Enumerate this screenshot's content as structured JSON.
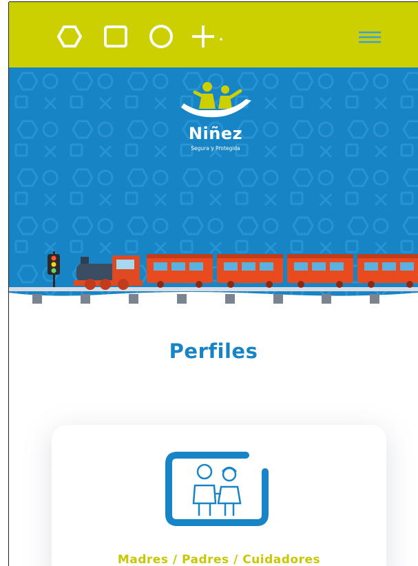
{
  "header": {
    "logo_shapes": [
      "hexagon",
      "square",
      "circle",
      "plus"
    ],
    "menu_icon": "hamburger-menu-icon",
    "bar_color": "#cdd000",
    "accent_color": "#1784c6"
  },
  "hero": {
    "brand_title": "Niñez",
    "brand_subtitle": "Segura y Protegida",
    "background_color": "#1784c6"
  },
  "section": {
    "title": "Perfiles"
  },
  "profile_card": {
    "label": "Madres / Padres / Cuidadores",
    "icon": "parents-icon"
  }
}
